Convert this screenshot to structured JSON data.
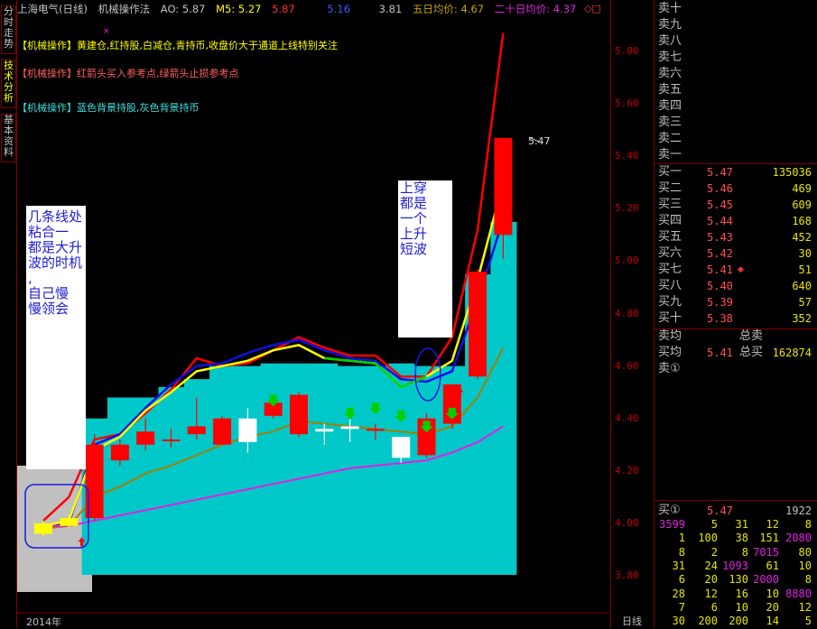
{
  "left_tabs": [
    "分时走势",
    "技术分析",
    "基本资料"
  ],
  "header": {
    "title": "上海电气(日线)",
    "indicator": "机械操作法",
    "ao": "AO: 5.87",
    "m5_label": "M5: 5.27",
    "red_value": "5.87",
    "blue_value": "5.16",
    "white_value": "3.81",
    "ma5_label": "五日均价: 4.67",
    "ma20_label": "二十日均价: 4.37",
    "corner_icons": "◇□"
  },
  "annotations": [
    {
      "tag": "【机械操作】",
      "text": "黄建仓,红持股,白减仓,青持币,收盘价大于通道上线特别关注"
    },
    {
      "tag": "【机械操作】",
      "text": "红箭头买入参考点,绿箭头止损参考点"
    },
    {
      "tag": "【机械操作】",
      "text": "蓝色背景持股,灰色背景持币"
    }
  ],
  "notes": {
    "left": [
      "几条线处",
      "粘合一",
      "都是大升",
      "波的时机",
      ",",
      "自己慢",
      "慢领会"
    ],
    "right": [
      "上穿",
      "都是",
      "一个",
      "上升",
      "短波"
    ]
  },
  "last_price_label": "5.47",
  "x_axis": {
    "year": "2014年",
    "period": "日线"
  },
  "colors": {
    "up": "#ff0000",
    "down": "#ffffff",
    "bg": "#000000",
    "cyan": "#00c8c8",
    "gray": "#c0c0c0",
    "yellow": "#ffff00",
    "blue": "#1010e0",
    "magenta": "#e020e0",
    "green": "#00d000",
    "olive": "#a08000",
    "frame": "#800000"
  },
  "chart_data": {
    "type": "candlestick",
    "y_ticks": [
      "5.80",
      "5.60",
      "5.40",
      "5.20",
      "5.00",
      "4.80",
      "4.60",
      "4.40",
      "4.20",
      "4.00",
      "3.80"
    ],
    "ylim": [
      3.74,
      5.88
    ],
    "candles": [
      {
        "o": 4.0,
        "c": 3.96,
        "h": 4.01,
        "l": 3.95
      },
      {
        "o": 3.99,
        "c": 4.02,
        "h": 4.03,
        "l": 3.98
      },
      {
        "o": 4.02,
        "c": 4.3,
        "h": 4.34,
        "l": 4.01
      },
      {
        "o": 4.24,
        "c": 4.3,
        "h": 4.32,
        "l": 4.22
      },
      {
        "o": 4.3,
        "c": 4.35,
        "h": 4.4,
        "l": 4.28
      },
      {
        "o": 4.32,
        "c": 4.32,
        "h": 4.36,
        "l": 4.29
      },
      {
        "o": 4.34,
        "c": 4.37,
        "h": 4.48,
        "l": 4.32
      },
      {
        "o": 4.3,
        "c": 4.4,
        "h": 4.41,
        "l": 4.3
      },
      {
        "o": 4.4,
        "c": 4.31,
        "h": 4.44,
        "l": 4.27
      },
      {
        "o": 4.41,
        "c": 4.46,
        "h": 4.47,
        "l": 4.4
      },
      {
        "o": 4.34,
        "c": 4.49,
        "h": 4.5,
        "l": 4.33
      },
      {
        "o": 4.36,
        "c": 4.35,
        "h": 4.38,
        "l": 4.3
      },
      {
        "o": 4.37,
        "c": 4.36,
        "h": 4.4,
        "l": 4.31
      },
      {
        "o": 4.36,
        "c": 4.36,
        "h": 4.38,
        "l": 4.32
      },
      {
        "o": 4.33,
        "c": 4.25,
        "h": 4.33,
        "l": 4.23
      },
      {
        "o": 4.26,
        "c": 4.4,
        "h": 4.42,
        "l": 4.25
      },
      {
        "o": 4.38,
        "c": 4.53,
        "h": 4.53,
        "l": 4.36
      },
      {
        "o": 4.56,
        "c": 4.96,
        "h": 4.97,
        "l": 4.55
      },
      {
        "o": 5.1,
        "c": 5.47,
        "h": 5.47,
        "l": 5.01
      }
    ],
    "series": [
      {
        "values": [
          4.01,
          4.1,
          4.32,
          4.34,
          4.42,
          4.51,
          4.63,
          4.6,
          4.61,
          4.66,
          4.71,
          4.67,
          4.64,
          4.64,
          4.56,
          4.56,
          4.71,
          5.12,
          5.87
        ]
      },
      {
        "values": [
          3.99,
          4.0,
          4.3,
          4.34,
          4.44,
          4.53,
          4.6,
          4.61,
          4.65,
          4.68,
          4.7,
          4.66,
          4.63,
          4.62,
          4.55,
          4.54,
          4.58,
          4.85,
          5.16
        ]
      },
      {
        "values": [
          3.99,
          4.01,
          4.28,
          4.33,
          4.43,
          4.5,
          4.58,
          4.6,
          4.62,
          4.66,
          4.68,
          4.63,
          4.62,
          4.61,
          4.52,
          4.56,
          4.62,
          4.93,
          5.3
        ]
      },
      {
        "values": [
          3.98,
          3.99,
          4.1,
          4.14,
          4.19,
          4.22,
          4.26,
          4.3,
          4.33,
          4.35,
          4.39,
          4.38,
          4.37,
          4.36,
          4.35,
          4.34,
          4.37,
          4.48,
          4.67
        ]
      },
      {
        "values": [
          3.99,
          3.99,
          4.01,
          4.03,
          4.05,
          4.07,
          4.09,
          4.11,
          4.13,
          4.15,
          4.17,
          4.19,
          4.21,
          4.22,
          4.23,
          4.24,
          4.27,
          4.31,
          4.37
        ]
      }
    ]
  },
  "order_book": {
    "sell": [
      {
        "label": "卖十"
      },
      {
        "label": "卖九"
      },
      {
        "label": "卖八"
      },
      {
        "label": "卖七"
      },
      {
        "label": "卖六"
      },
      {
        "label": "卖五"
      },
      {
        "label": "卖四"
      },
      {
        "label": "卖三"
      },
      {
        "label": "卖二"
      },
      {
        "label": "卖一"
      }
    ],
    "buy": [
      {
        "label": "买一",
        "price": "5.47",
        "vol": "135036"
      },
      {
        "label": "买二",
        "price": "5.46",
        "vol": "469"
      },
      {
        "label": "买三",
        "price": "5.45",
        "vol": "609"
      },
      {
        "label": "买四",
        "price": "5.44",
        "vol": "168"
      },
      {
        "label": "买五",
        "price": "5.43",
        "vol": "452"
      },
      {
        "label": "买六",
        "price": "5.42",
        "vol": "30"
      },
      {
        "label": "买七",
        "price": "5.41",
        "vol": "51"
      },
      {
        "label": "买八",
        "price": "5.40",
        "vol": "640"
      },
      {
        "label": "买九",
        "price": "5.39",
        "vol": "57"
      },
      {
        "label": "买十",
        "price": "5.38",
        "vol": "352"
      }
    ],
    "avg_sell_label": "卖均",
    "total_sell_label": "总卖",
    "avg_buy_label": "买均",
    "avg_buy_price": "5.41",
    "total_buy_label": "总买",
    "total_buy_value": "162874",
    "queue_sell_label": "卖①",
    "queue_buy_label": "买①",
    "queue_buy_price": "5.47",
    "queue_buy_count": "1922",
    "queue_rows": [
      [
        "3599",
        "5",
        "31",
        "12",
        "8"
      ],
      [
        "1",
        "100",
        "38",
        "151",
        "2080"
      ],
      [
        "8",
        "2",
        "8",
        "7015",
        "80"
      ],
      [
        "31",
        "24",
        "1093",
        "61",
        "10"
      ],
      [
        "6",
        "20",
        "130",
        "2000",
        "8"
      ],
      [
        "28",
        "12",
        "16",
        "10",
        "8880"
      ],
      [
        "7",
        "6",
        "10",
        "20",
        "12"
      ],
      [
        "30",
        "200",
        "200",
        "14",
        "5"
      ]
    ]
  }
}
